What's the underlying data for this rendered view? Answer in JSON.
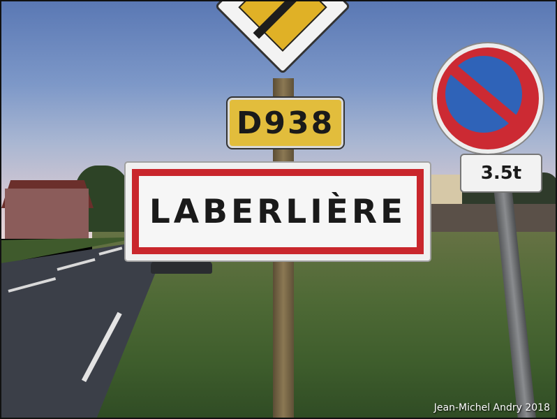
{
  "photo": {
    "road_sign": {
      "number": "D938"
    },
    "town_sign": {
      "name": "LABERLIÈRE"
    },
    "weight_plate": {
      "text": "3.5t"
    },
    "credit": "Jean-Michel Andry 2018"
  }
}
